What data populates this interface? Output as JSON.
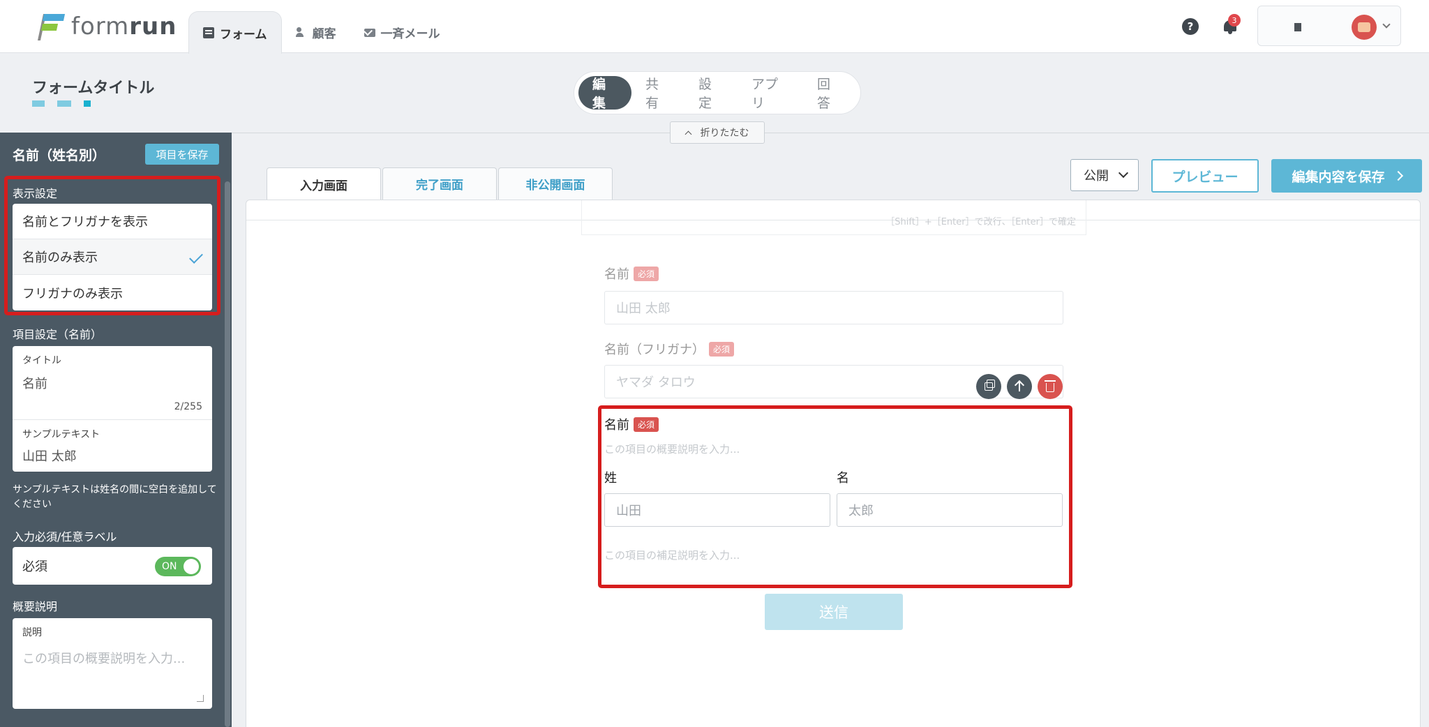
{
  "brand": {
    "name_light": "form",
    "name_bold": "run"
  },
  "nav": {
    "tabs": [
      {
        "label": "フォーム",
        "icon": "document-icon",
        "active": true
      },
      {
        "label": "顧客",
        "icon": "users-icon"
      },
      {
        "label": "一斉メール",
        "icon": "mail-icon"
      }
    ],
    "help": "?",
    "notifications": "3"
  },
  "header": {
    "form_title": "フォームタイトル",
    "modes": [
      "編集",
      "共有",
      "設定",
      "アプリ",
      "回答"
    ],
    "active_mode": "編集",
    "collapse_label": "折りたたむ"
  },
  "sidebar": {
    "title": "名前（姓名別）",
    "save_label": "項目を保存",
    "display_settings": {
      "label": "表示設定",
      "options": [
        "名前とフリガナを表示",
        "名前のみ表示",
        "フリガナのみ表示"
      ],
      "selected": "名前のみ表示"
    },
    "item_settings": {
      "label": "項目設定（名前）",
      "title_label": "タイトル",
      "title_value": "名前",
      "title_count": "2/255",
      "sample_label": "サンプルテキスト",
      "sample_value": "山田 太郎",
      "note": "サンプルテキストは姓名の間に空白を追加してください"
    },
    "required": {
      "label": "入力必須/任意ラベル",
      "value": "必須",
      "toggle": "ON"
    },
    "description": {
      "label": "概要説明",
      "field_label": "説明",
      "placeholder": "この項目の概要説明を入力..."
    }
  },
  "main": {
    "tabs": [
      "入力画面",
      "完了画面",
      "非公開画面"
    ],
    "active_tab": "入力画面",
    "publish_status": "公開",
    "preview_label": "プレビュー",
    "save_label": "編集内容を保存",
    "ghost_hint": "［Shift］+［Enter］で改行、［Enter］で確定",
    "fields": {
      "name": {
        "label": "名前",
        "required": "必須",
        "placeholder": "山田 太郎"
      },
      "kana": {
        "label": "名前（フリガナ）",
        "required": "必須",
        "placeholder": "ヤマダ タロウ"
      },
      "split": {
        "label": "名前",
        "required": "必須",
        "description_placeholder": "この項目の概要説明を入力...",
        "last_label": "姓",
        "last_placeholder": "山田",
        "first_label": "名",
        "first_placeholder": "太郎",
        "supplement_placeholder": "この項目の補足説明を入力..."
      }
    },
    "submit_label": "送信"
  },
  "colors": {
    "accent": "#5db7d6",
    "sidebar_bg": "#4b5964",
    "highlight": "#d61d1d",
    "required": "#d9534f"
  }
}
